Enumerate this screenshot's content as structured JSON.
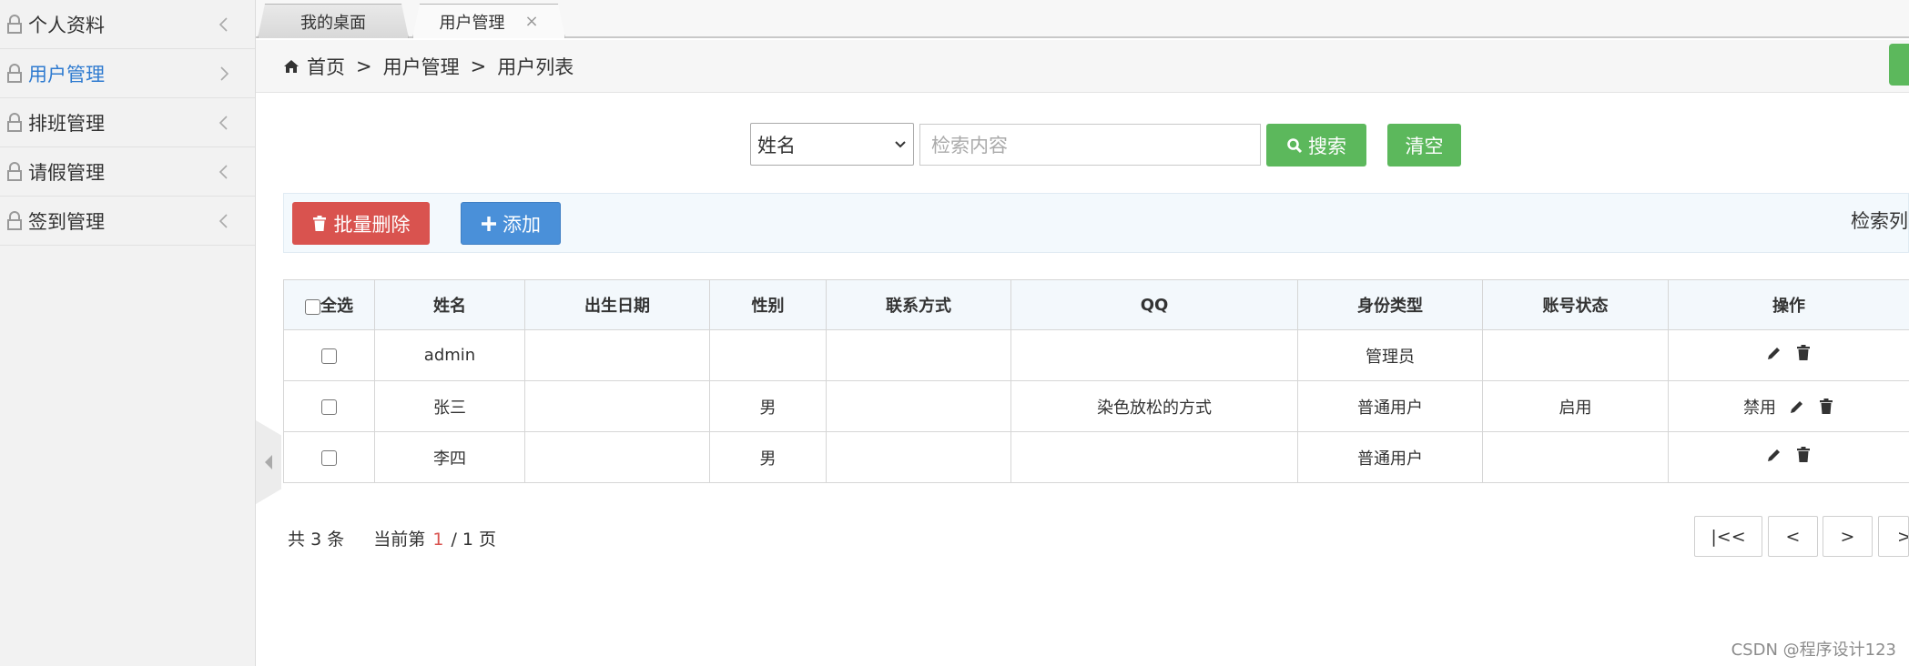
{
  "sidebar": {
    "items": [
      {
        "label": "个人资料",
        "active": false,
        "chevron": "left"
      },
      {
        "label": "用户管理",
        "active": true,
        "chevron": "right"
      },
      {
        "label": "排班管理",
        "active": false,
        "chevron": "left"
      },
      {
        "label": "请假管理",
        "active": false,
        "chevron": "left"
      },
      {
        "label": "签到管理",
        "active": false,
        "chevron": "left"
      }
    ]
  },
  "tabs": [
    {
      "label": "我的桌面"
    },
    {
      "label": "用户管理",
      "close": "×"
    }
  ],
  "breadcrumb": [
    "首页",
    "用户管理",
    "用户列表"
  ],
  "breadcrumb_sep": ">",
  "search": {
    "field_selected": "姓名",
    "placeholder": "检索内容",
    "search_label": "搜索",
    "clear_label": "清空"
  },
  "toolbar": {
    "batch_delete_label": "批量删除",
    "add_label": "添加",
    "right_text": "检索列"
  },
  "table": {
    "select_all_label": "全选",
    "columns": [
      "姓名",
      "出生日期",
      "性别",
      "联系方式",
      "QQ",
      "身份类型",
      "账号状态",
      "操作"
    ],
    "rows": [
      {
        "name": "admin",
        "birth": "",
        "gender": "",
        "contact": "",
        "qq": "",
        "role": "管理员",
        "status": "",
        "action_text": ""
      },
      {
        "name": "张三",
        "birth": "",
        "gender": "男",
        "contact": "",
        "qq": "染色放松的方式",
        "role": "普通用户",
        "status": "启用",
        "action_text": "禁用"
      },
      {
        "name": "李四",
        "birth": "",
        "gender": "男",
        "contact": "",
        "qq": "",
        "role": "普通用户",
        "status": "",
        "action_text": ""
      }
    ]
  },
  "pagination": {
    "total_prefix": "共",
    "total": "3",
    "total_suffix": "条",
    "current_prefix": "当前第",
    "current": "1",
    "of": "/ 1 页",
    "first": "|<<",
    "prev": "<",
    "next": ">",
    "last": ">>"
  },
  "watermark": "CSDN @程序设计123",
  "colors": {
    "green": "#5cb85c",
    "red": "#d9534f",
    "blue": "#4a90d9",
    "active_link": "#2f7bd0"
  }
}
